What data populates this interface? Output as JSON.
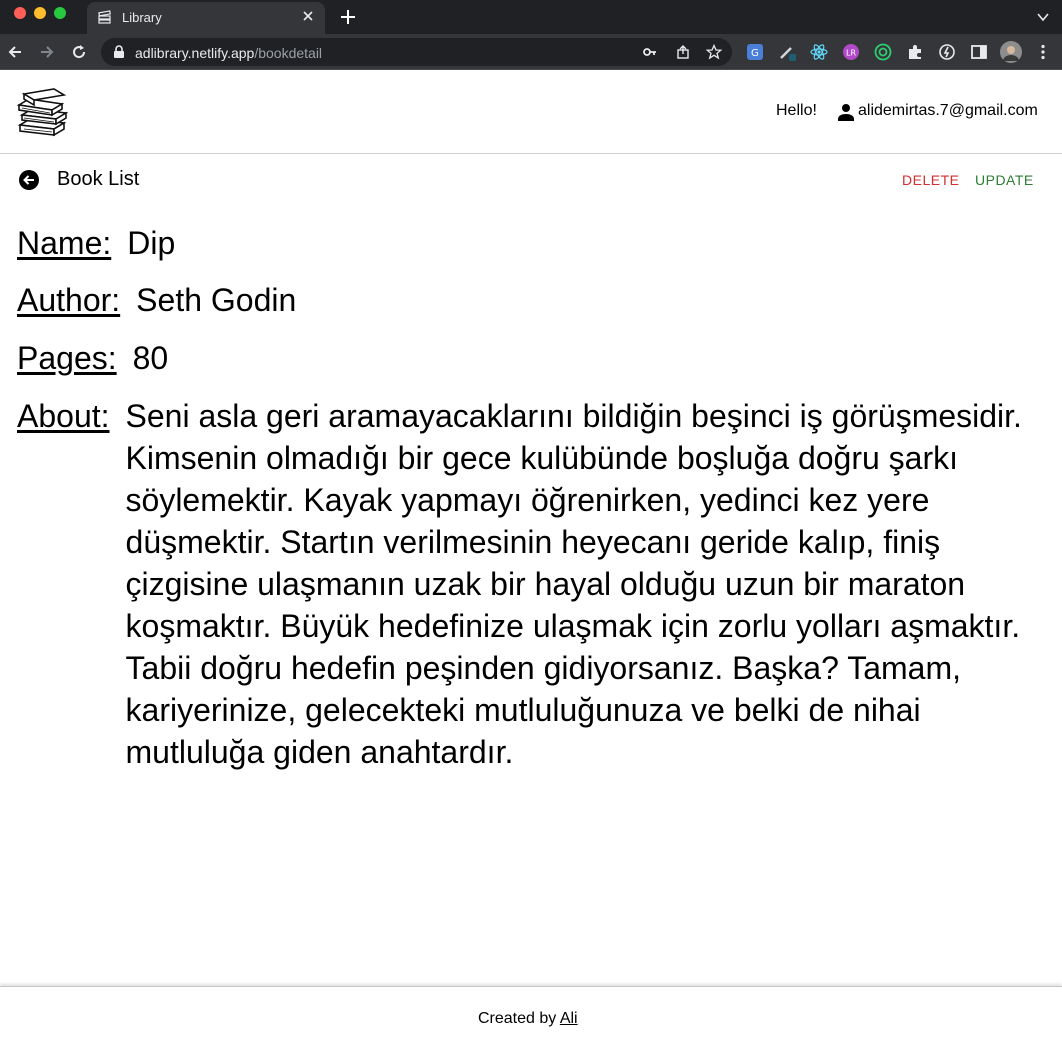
{
  "browser": {
    "tab_title": "Library",
    "url_host": "adlibrary.netlify.app",
    "url_path": "/bookdetail"
  },
  "header": {
    "greeting": "Hello!",
    "user_email": "alidemirtas.7@gmail.com"
  },
  "subbar": {
    "back_label": "Book List",
    "delete_label": "DELETE",
    "update_label": "UPDATE"
  },
  "book": {
    "name_label": "Name:",
    "name": "Dip",
    "author_label": "Author:",
    "author": "Seth Godin",
    "pages_label": "Pages:",
    "pages": "80",
    "about_label": "About:",
    "about": "Seni asla geri aramayacaklarını bildiğin beşinci iş görüşmesidir. Kimsenin olmadığı bir gece kulübünde boşluğa doğru şarkı söylemektir. Kayak yapmayı öğrenirken, yedinci kez yere düşmektir. Startın verilmesinin heyecanı geride kalıp, finiş çizgisine ulaşmanın uzak bir hayal olduğu uzun bir maraton koşmaktır. Büyük hedefinize ulaşmak için zorlu yolları aşmaktır. Tabii doğru hedefin peşinden gidiyorsanız. Başka? Tamam, kariyerinize, gelecekteki mutluluğunuza ve belki de nihai mutluluğa giden anahtardır."
  },
  "footer": {
    "prefix": "Created by ",
    "author_link": "Ali"
  },
  "colors": {
    "delete": "#d32f2f",
    "update": "#2e7d32",
    "chrome_dark": "#202124",
    "chrome_toolbar": "#35363a"
  },
  "icons": [
    "books-logo-icon",
    "user-icon",
    "back-arrow-icon",
    "lock-icon",
    "key-icon",
    "share-icon",
    "star-icon",
    "extensions-icon",
    "profile-avatar-icon"
  ]
}
